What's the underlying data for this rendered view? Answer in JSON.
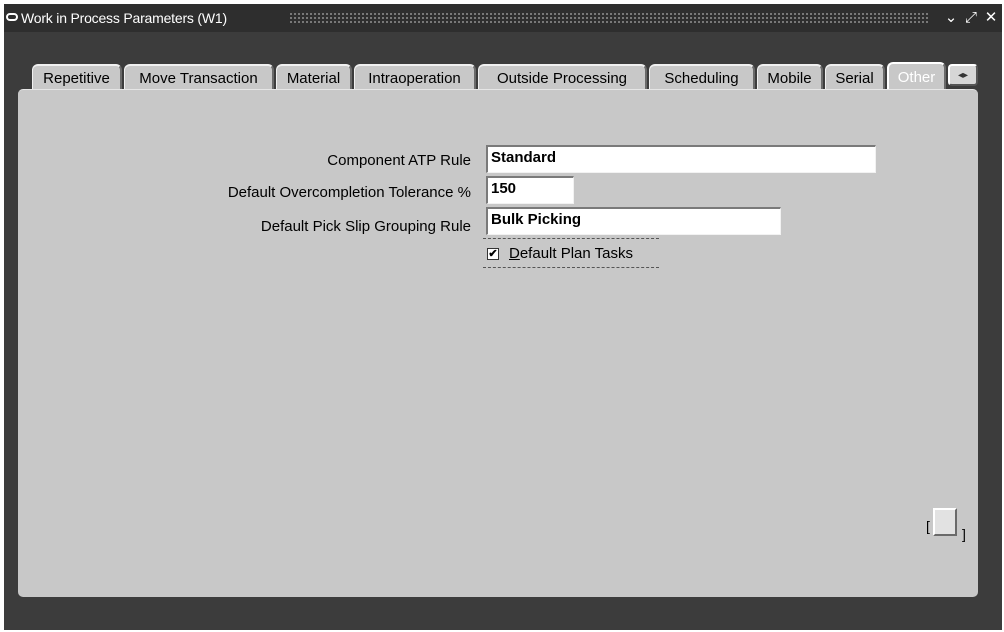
{
  "window": {
    "title": "Work in Process Parameters (W1)",
    "controls": {
      "minimize": "⌄",
      "maximize": "⤢",
      "close": "✕"
    }
  },
  "tabs": [
    {
      "label": "Repetitive"
    },
    {
      "label": "Move Transaction"
    },
    {
      "label": "Material"
    },
    {
      "label": "Intraoperation"
    },
    {
      "label": "Outside Processing"
    },
    {
      "label": "Scheduling"
    },
    {
      "label": "Mobile"
    },
    {
      "label": "Serial"
    },
    {
      "label": "Other",
      "active": true
    }
  ],
  "tab_scroll_icon": "◂▸",
  "form": {
    "component_atp_rule": {
      "label": "Component ATP Rule",
      "value": "Standard"
    },
    "overcompletion_tolerance": {
      "label": "Default Overcompletion Tolerance %",
      "value": "150"
    },
    "pick_slip_grouping_rule": {
      "label": "Default Pick Slip Grouping Rule",
      "value": "Bulk Picking"
    },
    "default_plan_tasks": {
      "label_first": "D",
      "label_rest": "efault Plan Tasks",
      "checked": true,
      "check_glyph": "✔"
    }
  },
  "descriptive_flexfield": {
    "open": "[",
    "close": "]"
  },
  "colors": {
    "title_bar": "#2e2e2e",
    "window_bg": "#3c3c3c",
    "panel_bg": "#c8c8c8",
    "field_bg": "#ffffff"
  }
}
